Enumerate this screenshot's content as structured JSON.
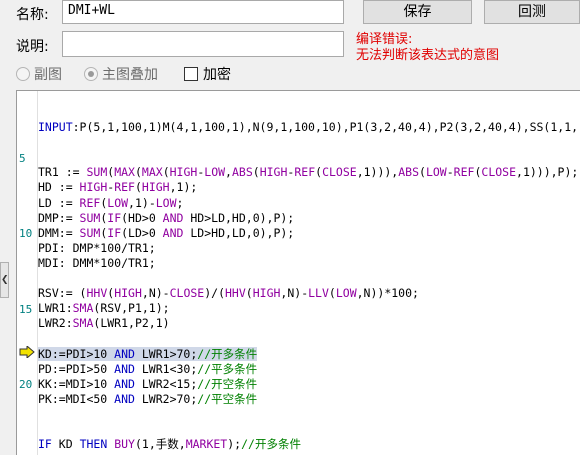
{
  "form": {
    "name_label": "名称:",
    "name_value": "DMI+WL",
    "desc_label": "说明:",
    "desc_value": ""
  },
  "buttons": {
    "save": "保存",
    "backtest": "回测"
  },
  "error": {
    "line1": "编译错误:",
    "line2": "无法判断该表达式的意图"
  },
  "options": {
    "subchart": "副图",
    "overlay": "主图叠加",
    "encrypt": "加密"
  },
  "gutter": {
    "l5": "5",
    "l10": "10",
    "l15": "15",
    "l20": "20"
  },
  "code": [
    {
      "k": "input",
      "text": "INPUT:P(5,1,100,1)M(4,1,100,1),N(9,1,100,10),P1(3,2,40,4),P2(3,2,40,4),SS(1,1,"
    },
    {
      "text": ""
    },
    {
      "text": ""
    },
    {
      "a": "TR1 := ",
      "b": "SUM(MAX(MAX(HIGH-LOW,ABS(HIGH-REF(CLOSE,1))),ABS(LOW-REF(CLOSE,1))),P);"
    },
    {
      "a": "HD := ",
      "b": "HIGH-REF(HIGH,1);"
    },
    {
      "a": "LD := ",
      "b": "REF(LOW,1)-LOW;"
    },
    {
      "a": "DMP:= ",
      "b": "SUM(IF(HD>0 AND HD>LD,HD,0),P);"
    },
    {
      "a": "DMM:= ",
      "b": "SUM(IF(LD>0 AND LD>HD,LD,0),P);"
    },
    {
      "a": "PDI: DMP*100/TR1;"
    },
    {
      "a": "MDI: DMM*100/TR1;"
    },
    {
      "text": ""
    },
    {
      "a": "RSV:= ",
      "b": "(HHV(HIGH,N)-CLOSE)/(HHV(HIGH,N)-LLV(LOW,N))*100;"
    },
    {
      "a": "LWR1:",
      "b": "SMA(RSV,P1,1);"
    },
    {
      "a": "LWR2:",
      "b": "SMA(LWR1,P2,1)"
    },
    {
      "text": ""
    },
    {
      "a": "KD:=PDI>10 AND LWR1>70;",
      "c": "//开多条件"
    },
    {
      "a": "PD:=PDI>50 AND LWR1<30;",
      "c": "//平多条件"
    },
    {
      "a": "KK:=MDI>10 AND LWR2<15;",
      "c": "//开空条件"
    },
    {
      "a": "PK:=MDI<50 AND LWR2>70;",
      "c": "//平空条件"
    },
    {
      "text": ""
    },
    {
      "text": ""
    },
    {
      "a": "IF KD THEN BUY(1,手数,MARKET);",
      "c": "//开多条件"
    }
  ]
}
